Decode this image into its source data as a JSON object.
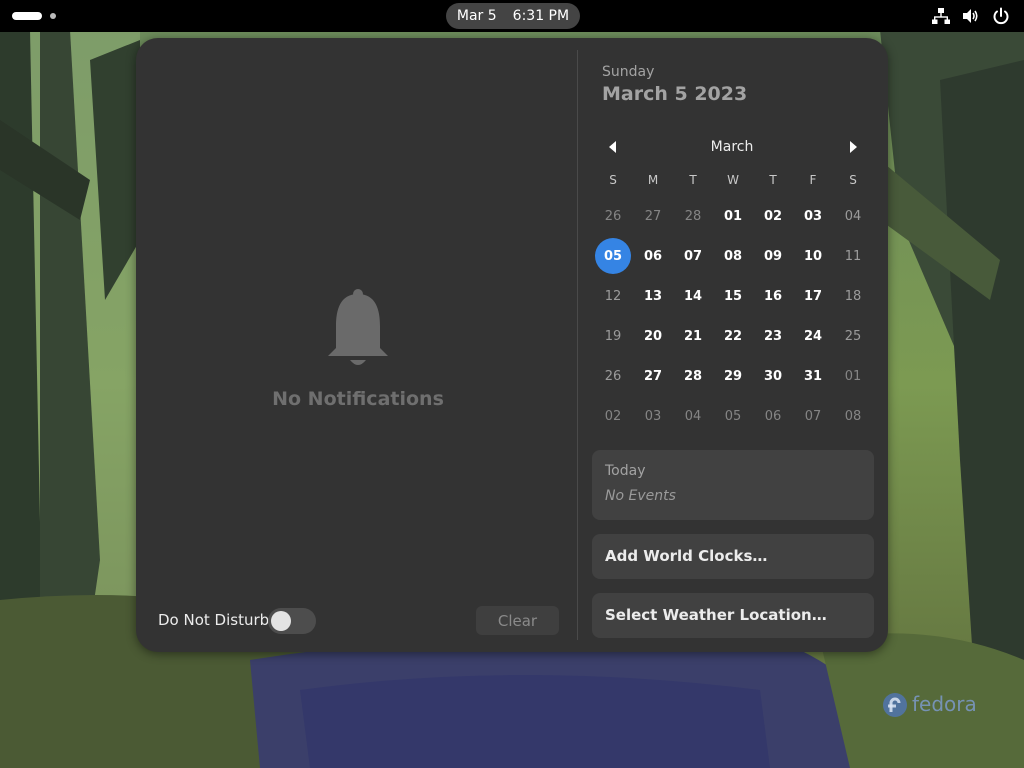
{
  "topbar": {
    "clock_date": "Mar 5",
    "clock_time": "6:31 PM",
    "tray_icons": [
      "network-icon",
      "volume-icon",
      "power-icon"
    ]
  },
  "notifications": {
    "empty_text": "No Notifications",
    "dnd_label": "Do Not Disturb",
    "dnd_enabled": false,
    "clear_label": "Clear"
  },
  "calendar": {
    "weekday": "Sunday",
    "full_date": "March 5 2023",
    "month": "March",
    "day_headers": [
      "S",
      "M",
      "T",
      "W",
      "T",
      "F",
      "S"
    ],
    "weeks": [
      [
        "26",
        "27",
        "28",
        "01",
        "02",
        "03",
        "04"
      ],
      [
        "05",
        "06",
        "07",
        "08",
        "09",
        "10",
        "11"
      ],
      [
        "12",
        "13",
        "14",
        "15",
        "16",
        "17",
        "18"
      ],
      [
        "19",
        "20",
        "21",
        "22",
        "23",
        "24",
        "25"
      ],
      [
        "26",
        "27",
        "28",
        "29",
        "30",
        "31",
        "01"
      ],
      [
        "02",
        "03",
        "04",
        "05",
        "06",
        "07",
        "08"
      ]
    ],
    "today_label": "05"
  },
  "events": {
    "title": "Today",
    "empty": "No Events"
  },
  "world_clocks_label": "Add World Clocks…",
  "weather_label": "Select Weather Location…",
  "colors": {
    "accent": "#3584e4",
    "panel_bg": "#333333",
    "card_bg": "#414141",
    "topbar_bg": "#000000"
  },
  "watermark_text": "fedora"
}
